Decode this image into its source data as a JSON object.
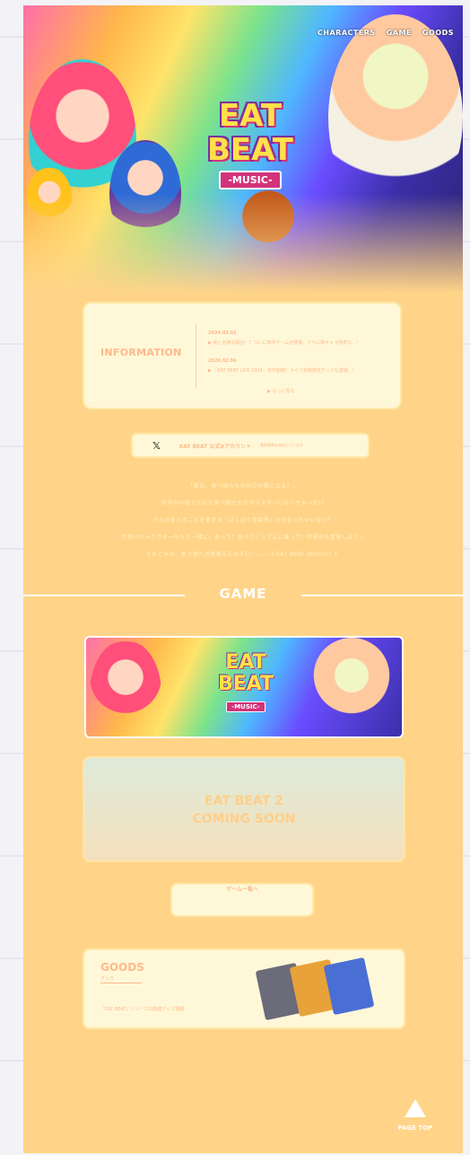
{
  "nav": {
    "items": [
      "CHARACTERS",
      "GAME",
      "GOODS"
    ]
  },
  "hero": {
    "logo_line1": "EAT",
    "logo_line2": "BEAT",
    "logo_sub": "-MUSIC-"
  },
  "info": {
    "title": "INFORMATION",
    "news": [
      {
        "date": "2024.03.02",
        "text": "▶ 食と音楽の融合！？ついに新作ゲームが登場、さらに新キャラ発表も…！"
      },
      {
        "date": "2024.02.04",
        "text": "▶ 「EAT BEAT LIVE 2024」本日開催！ライブ会場限定グッズも登場…！"
      }
    ],
    "more": "▶ もっと見る"
  },
  "x_account": {
    "icon": "𝕏",
    "label": "EAT BEAT 公式Xアカウント",
    "sub": "最新情報を発信しています"
  },
  "intro": {
    "lines": [
      "「君は、食べ物たちの叫びが聞こえる？」",
      "世界中の捨てられた食べ物たちがモンスターになっちゃった!?",
      "そんな食べることを愛する「ぱくぱく音楽隊」がだまっちゃいない！",
      "可愛いキャラクターたちと一緒に、食って！食べて！リズムに乗って！世界中を冒険しよう☆",
      "それじゃあ、食べ物への感謝を忘れずに！――《 EAT BEAT MUSIC!! 》"
    ]
  },
  "game": {
    "heading": "GAME",
    "card1_line1": "EAT",
    "card1_line2": "BEAT",
    "card1_sub": "-MUSIC-",
    "card2_line1": "EAT BEAT 2",
    "card2_line2": "COMING SOON",
    "button": "ゲーム一覧へ"
  },
  "goods": {
    "heading": "GOODS",
    "sub": "グッズ",
    "desc": "「EAT BEAT」シリーズの関連グッズ情報"
  },
  "page_top": {
    "label": "PAGE TOP"
  }
}
